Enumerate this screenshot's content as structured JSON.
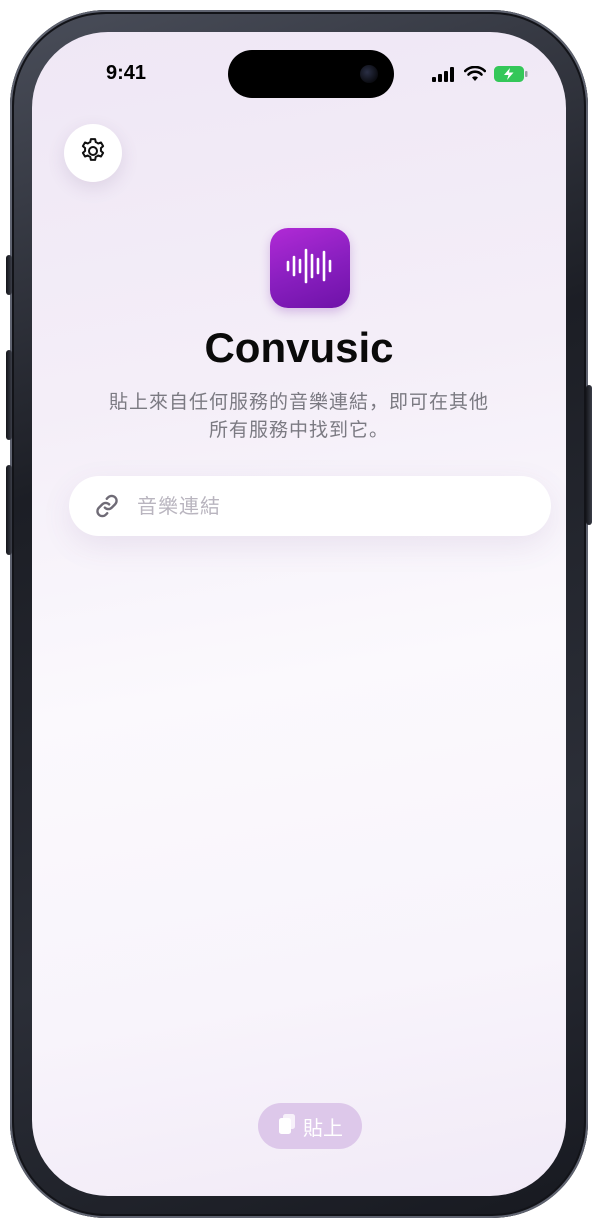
{
  "status_bar": {
    "time": "9:41",
    "battery_color": "#34c759"
  },
  "settings": {
    "icon": "gear-icon"
  },
  "app": {
    "name": "Convusic",
    "icon": "waveform-icon",
    "accent": "#8a1fc0",
    "subtitle": "貼上來自任何服務的音樂連結，即可在其他所有服務中找到它。"
  },
  "link_input": {
    "icon": "link-icon",
    "value": "",
    "placeholder": "音樂連結"
  },
  "paste_button": {
    "icon": "clipboard-icon",
    "label": "貼上",
    "color": "#ddc8ea"
  }
}
